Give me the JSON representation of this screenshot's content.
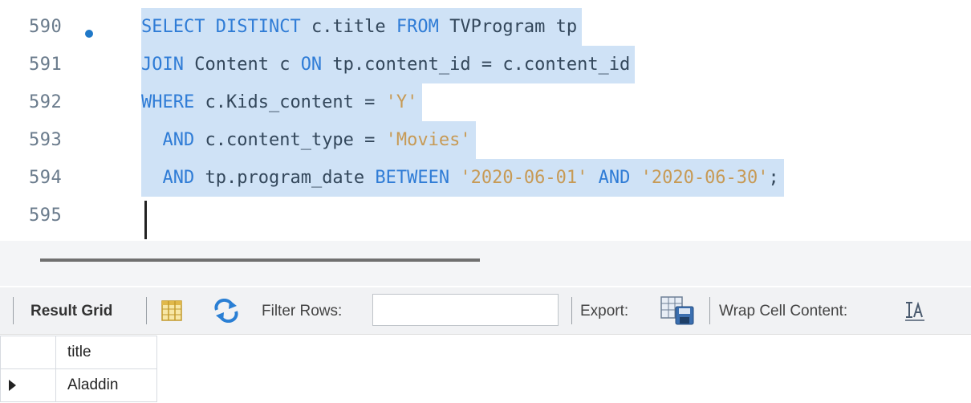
{
  "editor": {
    "lines": [
      {
        "number": "590",
        "has_marker": true,
        "tokens": [
          {
            "t": "SELECT",
            "c": "kw"
          },
          {
            "t": " ",
            "c": "id"
          },
          {
            "t": "DISTINCT",
            "c": "kw"
          },
          {
            "t": " c.title ",
            "c": "id"
          },
          {
            "t": "FROM",
            "c": "kw"
          },
          {
            "t": " TVProgram tp",
            "c": "id"
          }
        ]
      },
      {
        "number": "591",
        "has_marker": false,
        "tokens": [
          {
            "t": "JOIN",
            "c": "kw"
          },
          {
            "t": " Content c ",
            "c": "id"
          },
          {
            "t": "ON",
            "c": "kw"
          },
          {
            "t": " tp.content_id = c.content_id",
            "c": "id"
          }
        ]
      },
      {
        "number": "592",
        "has_marker": false,
        "tokens": [
          {
            "t": "WHERE",
            "c": "kw"
          },
          {
            "t": " c.Kids_content = ",
            "c": "id"
          },
          {
            "t": "'Y'",
            "c": "str"
          }
        ]
      },
      {
        "number": "593",
        "has_marker": false,
        "tokens": [
          {
            "t": "  ",
            "c": "id"
          },
          {
            "t": "AND",
            "c": "kw"
          },
          {
            "t": " c.content_type = ",
            "c": "id"
          },
          {
            "t": "'Movies'",
            "c": "str"
          }
        ]
      },
      {
        "number": "594",
        "has_marker": false,
        "tokens": [
          {
            "t": "  ",
            "c": "id"
          },
          {
            "t": "AND",
            "c": "kw"
          },
          {
            "t": " tp.program_date ",
            "c": "id"
          },
          {
            "t": "BETWEEN",
            "c": "kw"
          },
          {
            "t": " ",
            "c": "id"
          },
          {
            "t": "'2020-06-01'",
            "c": "str"
          },
          {
            "t": " ",
            "c": "id"
          },
          {
            "t": "AND",
            "c": "kw"
          },
          {
            "t": " ",
            "c": "id"
          },
          {
            "t": "'2020-06-30'",
            "c": "str"
          },
          {
            "t": ";",
            "c": "id"
          }
        ]
      },
      {
        "number": "595",
        "has_marker": false,
        "tokens": []
      }
    ],
    "colors": {
      "keyword": "#2f7cd6",
      "identifier": "#33475b",
      "string": "#c79a55",
      "selection": "#cfe2f6",
      "marker": "#1f78c8"
    }
  },
  "toolbar": {
    "result_grid_label": "Result Grid",
    "filter_label": "Filter Rows:",
    "filter_value": "",
    "export_label": "Export:",
    "wrap_label": "Wrap Cell Content:",
    "icons": [
      "grid-columns-icon",
      "refresh-icon",
      "export-icon",
      "wrap-text-icon"
    ]
  },
  "results": {
    "columns": [
      "title"
    ],
    "rows": [
      [
        "Aladdin"
      ]
    ]
  }
}
